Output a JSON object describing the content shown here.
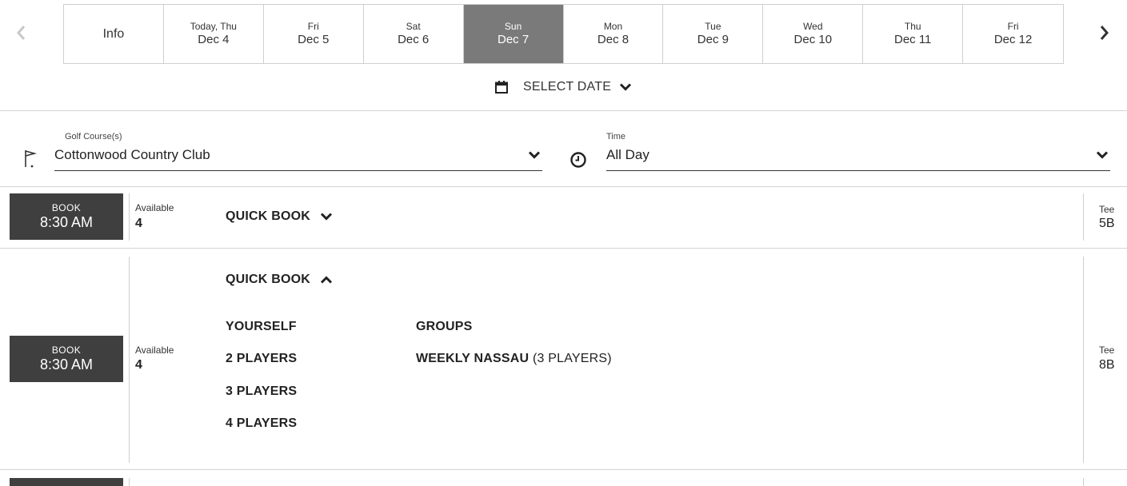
{
  "date_strip": {
    "info_label": "Info",
    "days": [
      {
        "line1": "Today, Thu",
        "line2": "Dec 4"
      },
      {
        "line1": "Fri",
        "line2": "Dec 5"
      },
      {
        "line1": "Sat",
        "line2": "Dec 6"
      },
      {
        "line1": "Sun",
        "line2": "Dec 7"
      },
      {
        "line1": "Mon",
        "line2": "Dec 8"
      },
      {
        "line1": "Tue",
        "line2": "Dec 9"
      },
      {
        "line1": "Wed",
        "line2": "Dec 10"
      },
      {
        "line1": "Thu",
        "line2": "Dec 11"
      },
      {
        "line1": "Fri",
        "line2": "Dec 12"
      }
    ],
    "active_day": "Sun Dec 7"
  },
  "select_date": {
    "label": "SELECT DATE"
  },
  "filters": {
    "course_label": "Golf Course(s)",
    "course_value": "Cottonwood Country Club",
    "time_label": "Time",
    "time_value": "All Day"
  },
  "rows": [
    {
      "book_label": "BOOK",
      "time": "8:30 AM",
      "available_label": "Available",
      "available_value": "4",
      "quick_book_label": "QUICK BOOK",
      "tee_label": "Tee",
      "tee_value": "5B"
    },
    {
      "book_label": "BOOK",
      "time": "8:30 AM",
      "available_label": "Available",
      "available_value": "4",
      "quick_book_label": "QUICK BOOK",
      "options": [
        "YOURSELF",
        "2 PLAYERS",
        "3 PLAYERS",
        "4 PLAYERS"
      ],
      "groups_heading": "GROUPS",
      "group_name": "WEEKLY NASSAU",
      "group_detail": "(3 PLAYERS)",
      "tee_label": "Tee",
      "tee_value": "8B"
    }
  ],
  "colors": {
    "active_day_bg": "#7a7a7a",
    "book_button_bg": "#3f3f3f",
    "divider": "#d4d4d4"
  },
  "icons": [
    "chevron-left-icon",
    "chevron-right-icon",
    "calendar-icon",
    "chevron-down-icon",
    "flag-icon",
    "clock-icon",
    "chevron-up-icon"
  ]
}
